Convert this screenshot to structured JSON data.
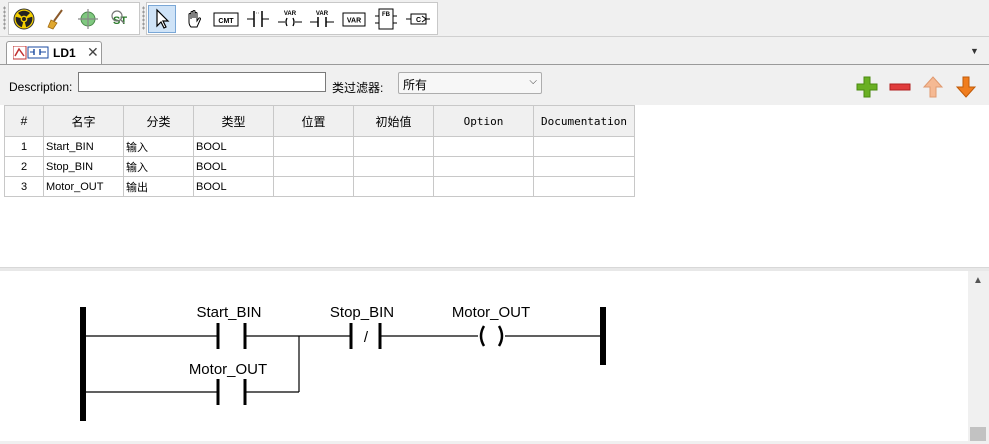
{
  "toolbar": {
    "group1": [
      "radiation-icon",
      "broom-icon",
      "crosshair-icon",
      "search-toggle-icon"
    ],
    "group2": [
      "pointer-icon",
      "hand-icon",
      "comment-icon",
      "contact-icon",
      "variable-contact-icon",
      "variable-coil-icon",
      "variable-icon",
      "function-block-icon",
      "coil-block-icon"
    ],
    "comment_text": "CMT",
    "var_text": "VAR",
    "fb_text": "FB"
  },
  "tabs": [
    {
      "label": "LD1",
      "close": "✕"
    }
  ],
  "filter": {
    "description_label": "Description:",
    "description_value": "",
    "class_filter_label": "类过滤器:",
    "class_filter_value": "所有"
  },
  "table": {
    "headers": [
      "#",
      "名字",
      "分类",
      "类型",
      "位置",
      "初始值",
      "Option",
      "Documentation"
    ],
    "rows": [
      [
        "1",
        "Start_BIN",
        "输入",
        "BOOL",
        "",
        "",
        "",
        ""
      ],
      [
        "2",
        "Stop_BIN",
        "输入",
        "BOOL",
        "",
        "",
        "",
        ""
      ],
      [
        "3",
        "Motor_OUT",
        "输出",
        "BOOL",
        "",
        "",
        "",
        ""
      ]
    ]
  },
  "ladder": {
    "contact_start": "Start_BIN",
    "contact_stop": "Stop_BIN",
    "contact_stop_symbol": "/",
    "coil_output": "Motor_OUT",
    "contact_hold": "Motor_OUT"
  },
  "colors": {
    "add": "#6ab023",
    "remove": "#e03c3c",
    "up": "#f5b993",
    "down": "#f07d1e"
  }
}
